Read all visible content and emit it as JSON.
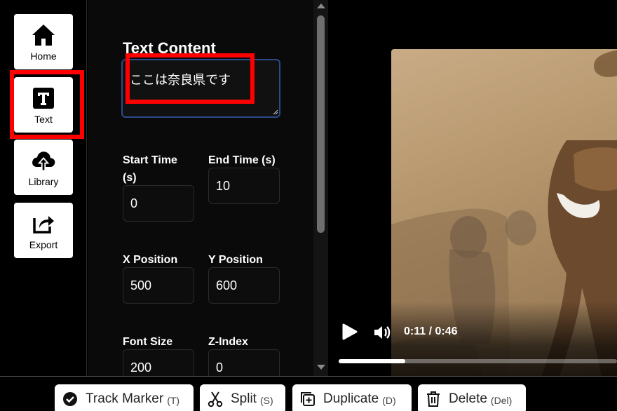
{
  "nav": {
    "items": [
      {
        "label": "Home",
        "icon": "home-icon"
      },
      {
        "label": "Text",
        "icon": "text-icon"
      },
      {
        "label": "Library",
        "icon": "cloud-upload-icon"
      },
      {
        "label": "Export",
        "icon": "share-export-icon"
      }
    ]
  },
  "panel": {
    "title": "Text Content",
    "text_value": "ここは奈良県です",
    "fields": {
      "start_time": {
        "label": "Start Time (s)",
        "value": "0"
      },
      "end_time": {
        "label": "End Time (s)",
        "value": "10"
      },
      "x_position": {
        "label": "X Position",
        "value": "500"
      },
      "y_position": {
        "label": "Y Position",
        "value": "600"
      },
      "font_size": {
        "label": "Font Size",
        "value": "200"
      },
      "z_index": {
        "label": "Z-Index",
        "value": "0"
      }
    }
  },
  "video": {
    "time": "0:11 / 0:46",
    "progress_fraction": 0.24
  },
  "toolbar": {
    "track_marker": {
      "label": "Track Marker",
      "key": "(T)"
    },
    "split": {
      "label": "Split",
      "key": "(S)"
    },
    "duplicate": {
      "label": "Duplicate",
      "key": "(D)"
    },
    "delete": {
      "label": "Delete",
      "key": "(Del)"
    }
  },
  "colors": {
    "highlight": "#ff0000",
    "textarea_border": "#2c4a8a",
    "background": "#000000"
  }
}
